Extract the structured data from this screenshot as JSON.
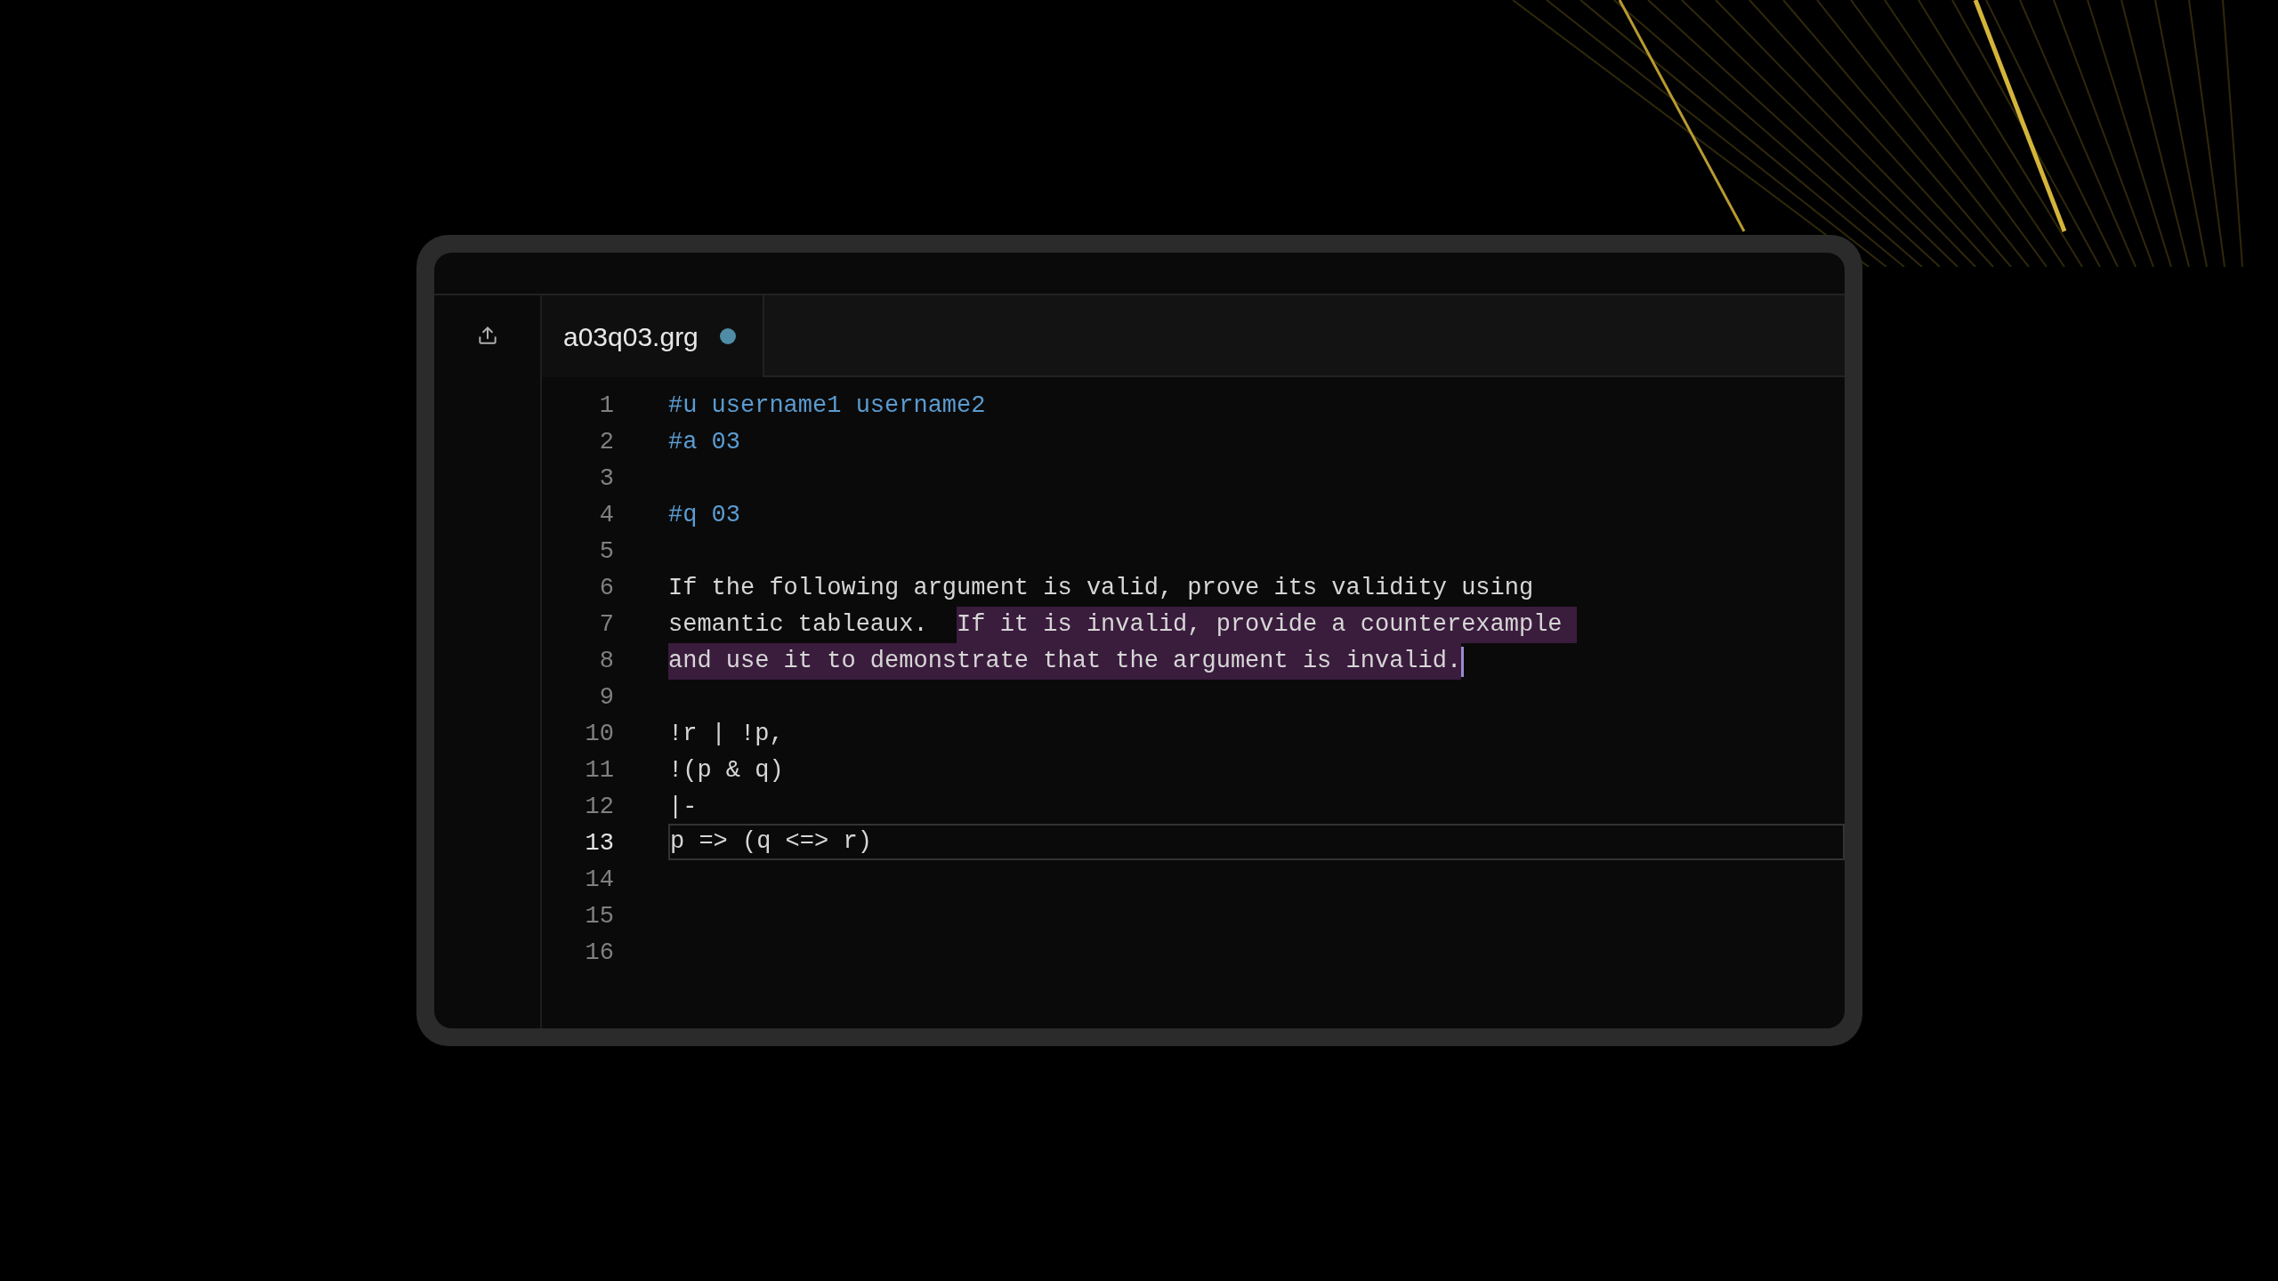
{
  "tabs": [
    {
      "label": "a03q03.grg",
      "selected": true,
      "modified": true
    }
  ],
  "editor": {
    "lines": [
      {
        "number": "1",
        "current": false,
        "kind": "directive",
        "segments": [
          {
            "text": "#u username1 username2",
            "selected": false
          }
        ]
      },
      {
        "number": "2",
        "current": false,
        "kind": "directive",
        "segments": [
          {
            "text": "#a 03",
            "selected": false
          }
        ]
      },
      {
        "number": "3",
        "current": false
      },
      {
        "number": "4",
        "current": false,
        "kind": "directive",
        "segments": [
          {
            "text": "#q 03",
            "selected": false
          }
        ]
      },
      {
        "number": "5",
        "current": false
      },
      {
        "number": "6",
        "current": false,
        "kind": "text",
        "segments": [
          {
            "text": "If the following argument is valid, prove its validity using",
            "selected": false
          }
        ]
      },
      {
        "number": "7",
        "current": false,
        "kind": "text",
        "segments": [
          {
            "text": "semantic tableaux.  ",
            "selected": false
          },
          {
            "text": "If it is invalid, provide a counterexample ",
            "selected": true
          }
        ]
      },
      {
        "number": "8",
        "current": false,
        "kind": "text",
        "cursor": true,
        "segments": [
          {
            "text": "and use it to demonstrate that the argument is invalid.",
            "selected": true
          }
        ]
      },
      {
        "number": "9",
        "current": false
      },
      {
        "number": "10",
        "current": false,
        "kind": "text",
        "segments": [
          {
            "text": "!r | !p,",
            "selected": false
          }
        ]
      },
      {
        "number": "11",
        "current": false,
        "kind": "text",
        "segments": [
          {
            "text": "!(p & q)",
            "selected": false
          }
        ]
      },
      {
        "number": "12",
        "current": false,
        "kind": "text",
        "segments": [
          {
            "text": "|-",
            "selected": false
          }
        ]
      },
      {
        "number": "13",
        "current": true,
        "kind": "text",
        "segments": [
          {
            "text": "p => (q <=> r)",
            "selected": false
          }
        ]
      },
      {
        "number": "14",
        "current": false
      },
      {
        "number": "15",
        "current": false
      },
      {
        "number": "16",
        "current": false
      }
    ]
  }
}
